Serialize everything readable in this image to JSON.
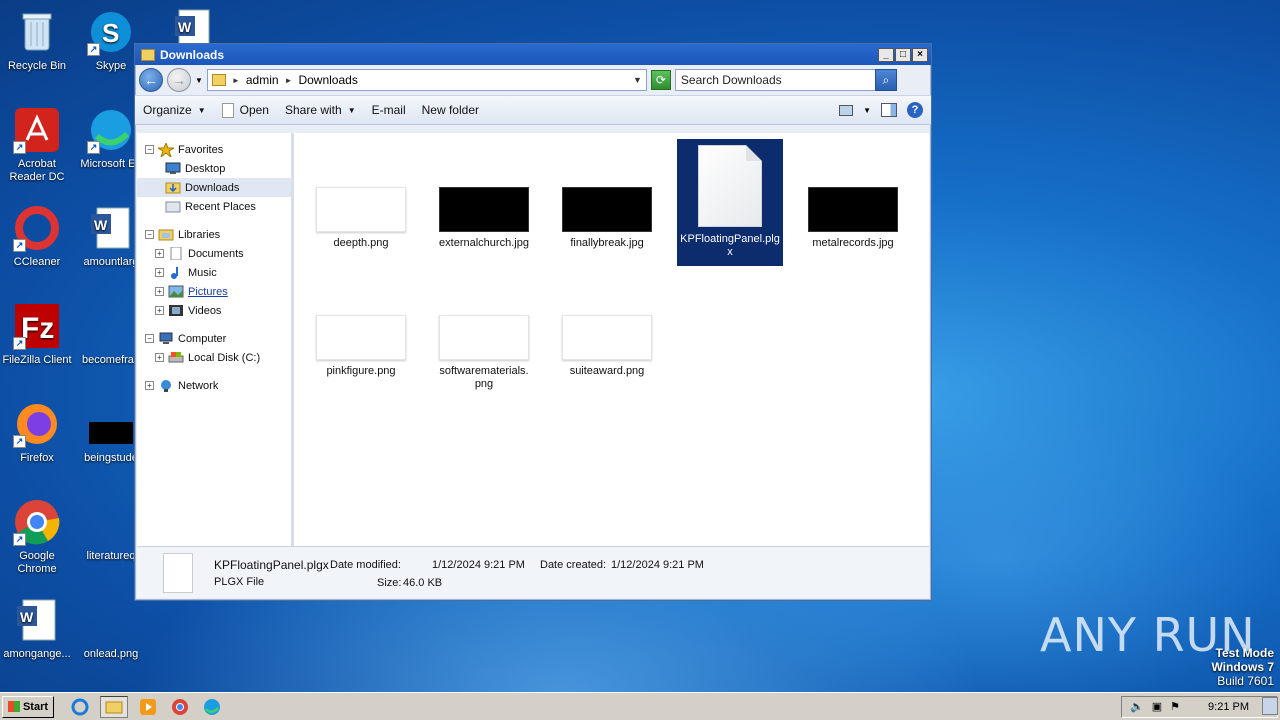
{
  "desktop": {
    "icons": [
      {
        "label": "Recycle Bin",
        "icon": "recycle-bin-icon"
      },
      {
        "label": "Skype",
        "icon": "skype-icon"
      },
      {
        "label": "Acrobat Reader DC",
        "icon": "acrobat-icon"
      },
      {
        "label": "Microsoft Ed",
        "icon": "edge-icon"
      },
      {
        "label": "CCleaner",
        "icon": "ccleaner-icon"
      },
      {
        "label": "amountlarg",
        "icon": "word-doc-icon"
      },
      {
        "label": "FileZilla Client",
        "icon": "filezilla-icon"
      },
      {
        "label": "becomefran",
        "icon": "file-icon"
      },
      {
        "label": "Firefox",
        "icon": "firefox-icon"
      },
      {
        "label": "beingstude",
        "icon": "image-icon"
      },
      {
        "label": "Google Chrome",
        "icon": "chrome-icon"
      },
      {
        "label": "literatureq",
        "icon": "file-icon"
      },
      {
        "label": "amongange...",
        "icon": "word-doc-icon"
      },
      {
        "label": "onlead.png",
        "icon": "image-icon"
      }
    ],
    "watermark": {
      "line1": "Test Mode",
      "line2": "Windows 7",
      "line3": "Build 7601"
    },
    "brand": "ANY RUN"
  },
  "window": {
    "title": "Downloads",
    "address": {
      "crumbs": [
        "admin",
        "Downloads"
      ]
    },
    "search_placeholder": "Search Downloads",
    "toolbar": {
      "organize": "Organize",
      "open": "Open",
      "share_with": "Share with",
      "email": "E-mail",
      "new_folder": "New folder"
    },
    "nav": {
      "favorites": "Favorites",
      "desktop": "Desktop",
      "downloads": "Downloads",
      "recent_places": "Recent Places",
      "libraries": "Libraries",
      "documents": "Documents",
      "music": "Music",
      "pictures": "Pictures",
      "videos": "Videos",
      "computer": "Computer",
      "local_disk": "Local Disk (C:)",
      "network": "Network"
    },
    "files": [
      {
        "name": "deepth.png",
        "thumb": "light"
      },
      {
        "name": "externalchurch.jpg",
        "thumb": "dark"
      },
      {
        "name": "finallybreak.jpg",
        "thumb": "dark"
      },
      {
        "name": "KPFloatingPanel.plgx",
        "thumb": "doc",
        "selected": true
      },
      {
        "name": "metalrecords.jpg",
        "thumb": "dark"
      },
      {
        "name": "pinkfigure.png",
        "thumb": "light"
      },
      {
        "name": "softwarematerials.png",
        "thumb": "light"
      },
      {
        "name": "suiteaward.png",
        "thumb": "light"
      }
    ],
    "details": {
      "name": "KPFloatingPanel.plgx",
      "type": "PLGX File",
      "date_modified_label": "Date modified:",
      "date_modified": "1/12/2024 9:21 PM",
      "size_label": "Size:",
      "size": "46.0 KB",
      "date_created_label": "Date created:",
      "date_created": "1/12/2024 9:21 PM"
    }
  },
  "taskbar": {
    "start": "Start",
    "time": "9:21 PM"
  }
}
